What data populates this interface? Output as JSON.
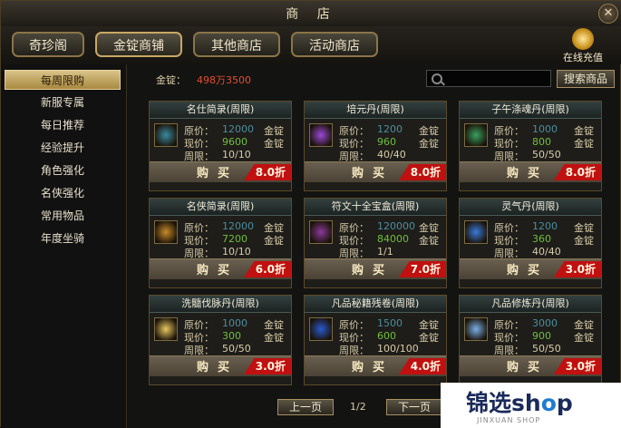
{
  "window": {
    "title": "商 店",
    "close_glyph": "✕"
  },
  "tabs": [
    "奇珍阁",
    "金锭商铺",
    "其他商店",
    "活动商店"
  ],
  "recharge": {
    "label": "在线充值"
  },
  "sidebar": {
    "items": [
      "每周限购",
      "新服专属",
      "每日推荐",
      "经验提升",
      "角色强化",
      "名侠强化",
      "常用物品",
      "年度坐骑"
    ],
    "active": 0
  },
  "balance": {
    "label": "金锭：",
    "value": "498万3500"
  },
  "search": {
    "placeholder": "",
    "value": "",
    "button_label": "搜索商品"
  },
  "card_labels": {
    "orig": "原价：",
    "now": "现价：",
    "limit": "周限：",
    "currency": "金锭",
    "buy": "购买"
  },
  "items": [
    {
      "name": "名仕简录(周限)",
      "orig": "12000",
      "now": "9600",
      "limit": "10/10",
      "discount": "8.0折",
      "icon": "book-icon",
      "icon_color": "#3a8aa0"
    },
    {
      "name": "培元丹(周限)",
      "orig": "1200",
      "now": "960",
      "limit": "40/40",
      "discount": "8.0折",
      "icon": "purple-pill-icon",
      "icon_color": "#9a4ad8"
    },
    {
      "name": "子午涤魂丹(周限)",
      "orig": "1000",
      "now": "800",
      "limit": "50/50",
      "discount": "8.0折",
      "icon": "green-pill-icon",
      "icon_color": "#3aa060"
    },
    {
      "name": "名侠简录(周限)",
      "orig": "12000",
      "now": "7200",
      "limit": "10/10",
      "discount": "6.0折",
      "icon": "scroll-icon",
      "icon_color": "#c88a2a"
    },
    {
      "name": "符文十全宝盒(周限)",
      "orig": "120000",
      "now": "84000",
      "limit": "1/1",
      "discount": "7.0折",
      "icon": "chest-icon",
      "icon_color": "#8a3a9a"
    },
    {
      "name": "灵气丹(周限)",
      "orig": "1200",
      "now": "360",
      "limit": "40/40",
      "discount": "3.0折",
      "icon": "blue-pill-icon",
      "icon_color": "#3a7ad8"
    },
    {
      "name": "洗髓伐脉丹(周限)",
      "orig": "1000",
      "now": "300",
      "limit": "50/50",
      "discount": "3.0折",
      "icon": "gold-pill-icon",
      "icon_color": "#e8c860"
    },
    {
      "name": "凡品秘籍残卷(周限)",
      "orig": "1500",
      "now": "600",
      "limit": "100/100",
      "discount": "4.0折",
      "icon": "blue-book-icon",
      "icon_color": "#2a5ad0"
    },
    {
      "name": "凡品修炼丹(周限)",
      "orig": "3000",
      "now": "900",
      "limit": "50/50",
      "discount": "3.0折",
      "icon": "orb-icon",
      "icon_color": "#7ab0e8"
    }
  ],
  "pagination": {
    "prev_label": "上一页",
    "page": "1/2",
    "next_label": "下一页"
  },
  "watermark": {
    "brand_a": "锦选sh",
    "brand_o": "o",
    "brand_b": "p",
    "sub": "JINXUAN SHOP"
  }
}
